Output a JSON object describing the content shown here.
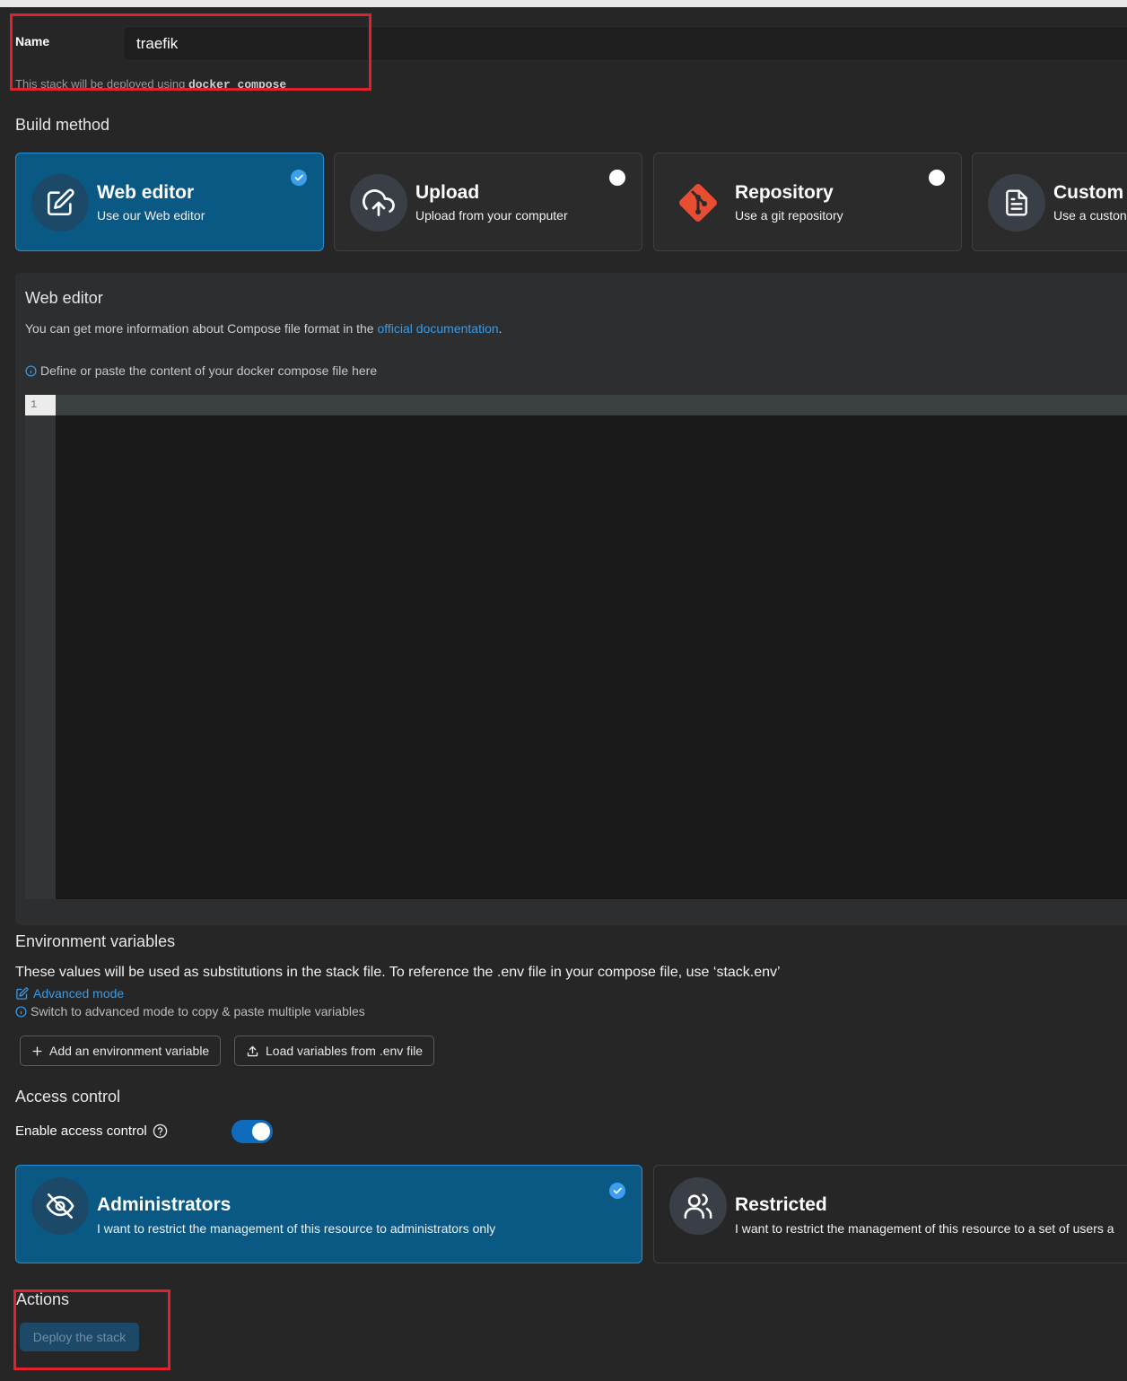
{
  "name_field": {
    "label": "Name",
    "value": "traefik"
  },
  "deploy_hint": {
    "text": "This stack will be deployed using",
    "tool": "docker compose"
  },
  "build_method": {
    "title": "Build method",
    "options": [
      {
        "title": "Web editor",
        "subtitle": "Use our Web editor",
        "selected": true,
        "icon": "edit-icon"
      },
      {
        "title": "Upload",
        "subtitle": "Upload from your computer",
        "selected": false,
        "icon": "cloud-upload-icon"
      },
      {
        "title": "Repository",
        "subtitle": "Use a git repository",
        "selected": false,
        "icon": "git-icon"
      },
      {
        "title": "Custom",
        "subtitle": "Use a custon",
        "selected": false,
        "icon": "file-text-icon"
      }
    ]
  },
  "web_editor": {
    "title": "Web editor",
    "info_prefix": "You can get more information about Compose file format in the ",
    "info_link": "official documentation",
    "info_suffix": ".",
    "define_hint": "Define or paste the content of your docker compose file here",
    "line_number": "1"
  },
  "env_vars": {
    "title": "Environment variables",
    "description": "These values will be used as substitutions in the stack file. To reference the .env file in your compose file, use ‘stack.env’",
    "advanced_mode": "Advanced mode",
    "advanced_hint": "Switch to advanced mode to copy & paste multiple variables",
    "add_button": "Add an environment variable",
    "load_button": "Load variables from .env file"
  },
  "access_control": {
    "title": "Access control",
    "toggle_label": "Enable access control",
    "enabled": true,
    "options": [
      {
        "title": "Administrators",
        "subtitle": "I want to restrict the management of this resource to administrators only",
        "selected": true,
        "icon": "eye-off-icon"
      },
      {
        "title": "Restricted",
        "subtitle": "I want to restrict the management of this resource to a set of users a",
        "selected": false,
        "icon": "users-icon"
      }
    ]
  },
  "actions": {
    "title": "Actions",
    "deploy_button": "Deploy the stack"
  },
  "colors": {
    "accent": "#0a5985",
    "link": "#3a9be6",
    "highlight": "#e2212c",
    "git": "#e84d31"
  }
}
